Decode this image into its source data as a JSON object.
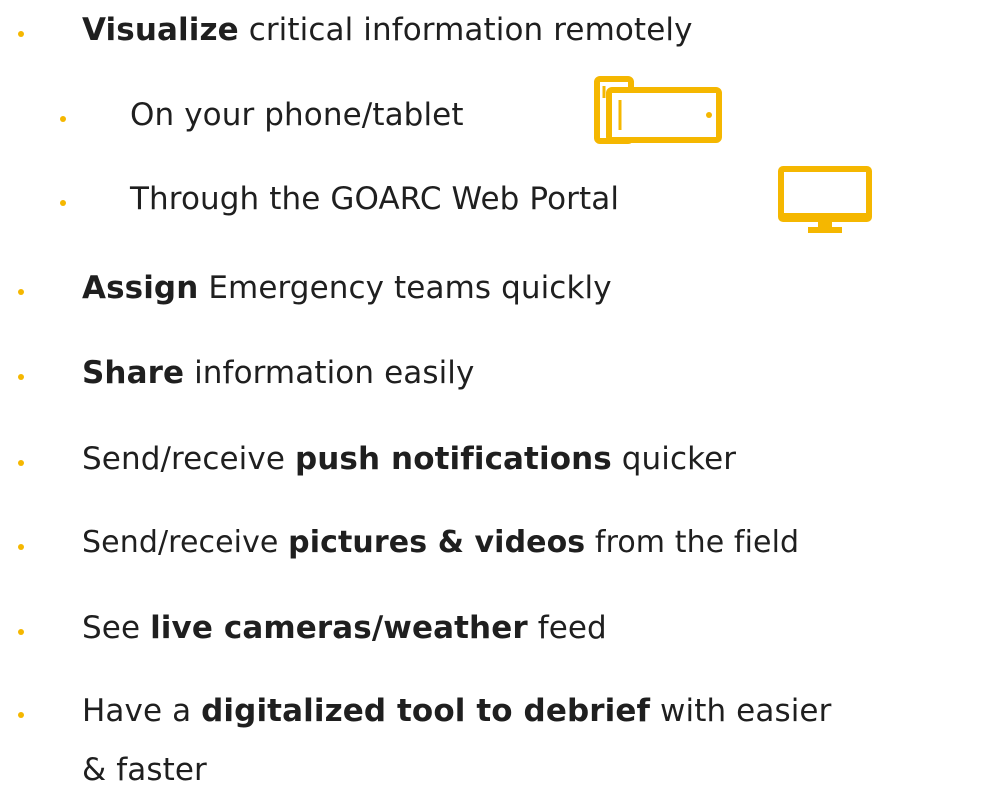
{
  "accent_color": "#f5b700",
  "items": [
    {
      "level": 1,
      "pre": "",
      "bold": "Visualize",
      "post": " critical information remotely"
    },
    {
      "level": 2,
      "text": "On your phone/tablet",
      "icon": "phone-tablet-icon"
    },
    {
      "level": 2,
      "text": "Through the GOARC Web Portal",
      "icon": "monitor-icon"
    },
    {
      "level": 1,
      "pre": "",
      "bold": "Assign",
      "post": " Emergency teams quickly"
    },
    {
      "level": 1,
      "pre": "",
      "bold": "Share",
      "post": " information easily"
    },
    {
      "level": 1,
      "pre": "Send/receive ",
      "bold": "push notifications",
      "post": " quicker"
    },
    {
      "level": 1,
      "pre": "Send/receive ",
      "bold": "pictures & videos",
      "post": " from the field"
    },
    {
      "level": 1,
      "pre": "See ",
      "bold": "live cameras/weather",
      "post": " feed"
    },
    {
      "level": 1,
      "pre": "Have a ",
      "bold": "digitalized tool to debrief",
      "post": " with easier"
    },
    {
      "level": 0,
      "text": "& faster"
    }
  ]
}
